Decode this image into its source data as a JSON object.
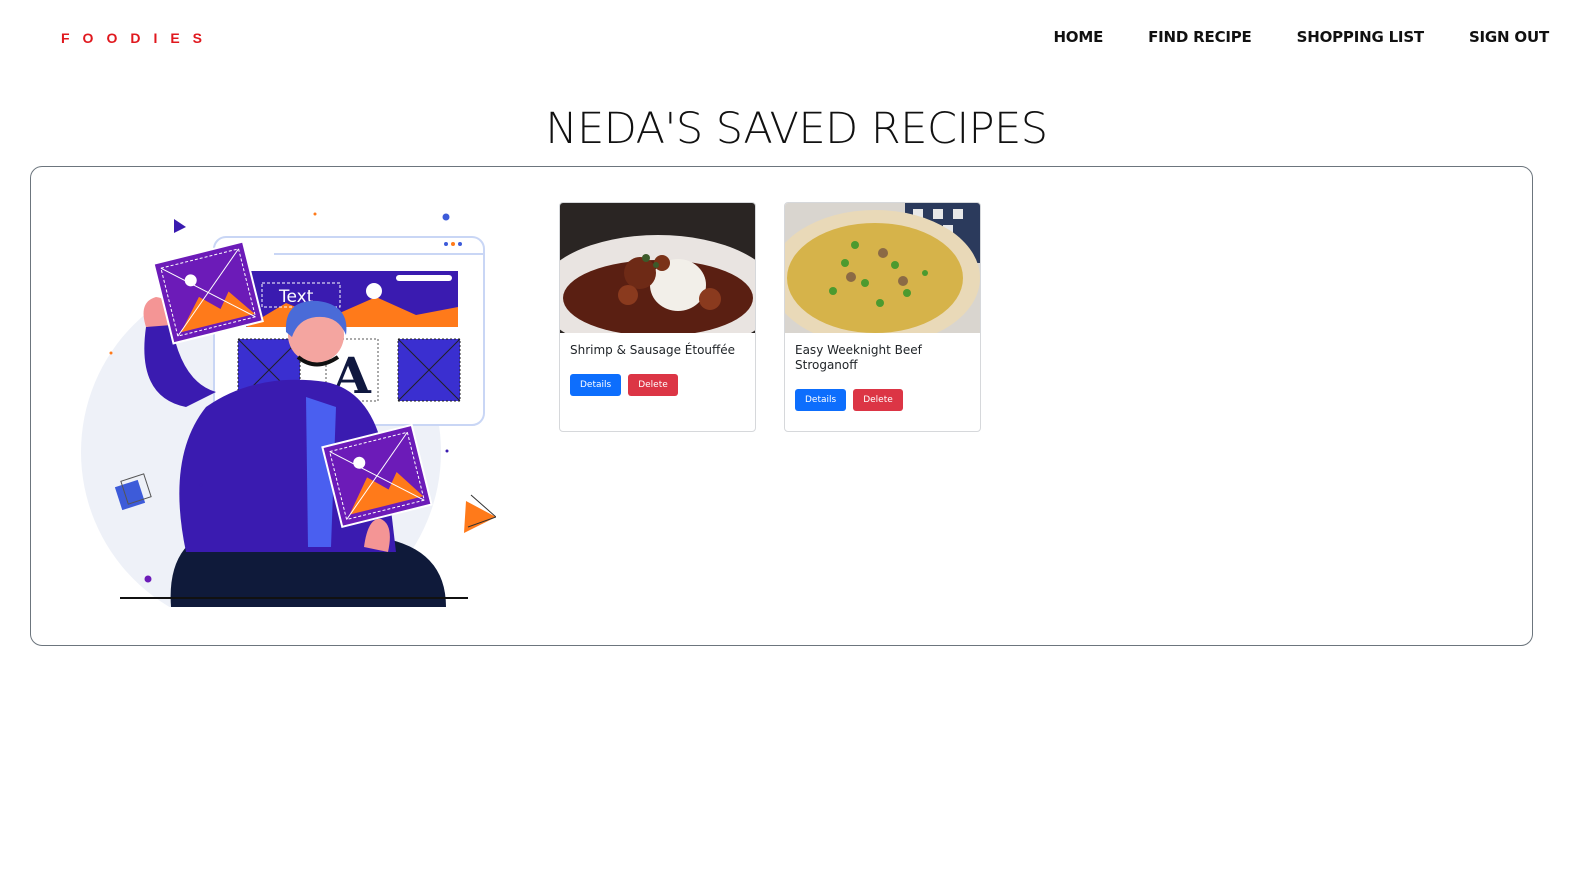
{
  "nav": {
    "brand": "FOODIES",
    "links": [
      "HOME",
      "FIND RECIPE",
      "SHOPPING LIST",
      "SIGN OUT"
    ]
  },
  "page": {
    "title": "NEDA'S SAVED RECIPES"
  },
  "illustration": {
    "text_label": "Text",
    "letter": "A"
  },
  "recipes": [
    {
      "title": "Shrimp & Sausage Étouffée",
      "details_label": "Details",
      "delete_label": "Delete"
    },
    {
      "title": "Easy Weeknight Beef Stroganoff",
      "details_label": "Details",
      "delete_label": "Delete"
    }
  ],
  "colors": {
    "brand": "#e0181e",
    "primary": "#0d6efd",
    "danger": "#dc3545"
  }
}
